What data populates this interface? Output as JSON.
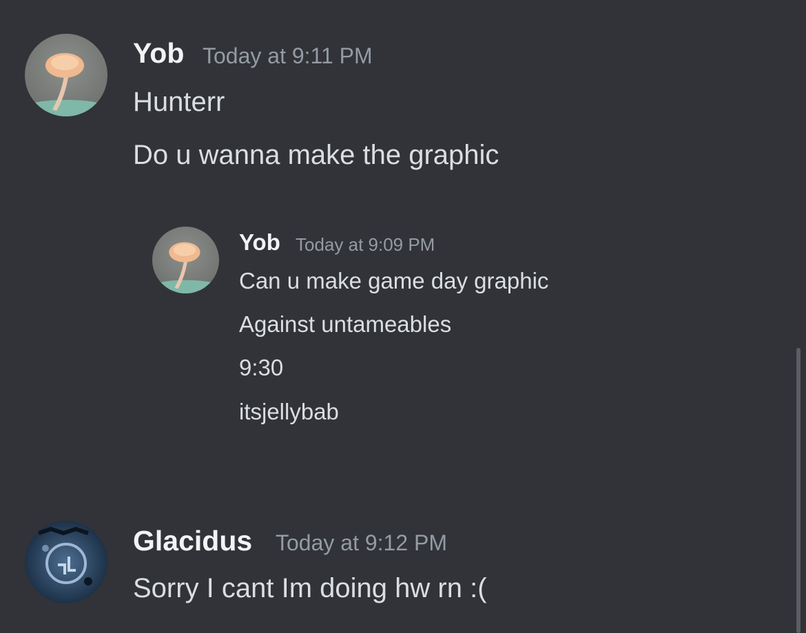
{
  "messages": [
    {
      "author": "Yob",
      "timestamp": "Today at 9:11 PM",
      "avatar": "mushroom-avatar",
      "lines": [
        "Hunterr",
        "Do u wanna make the graphic"
      ]
    },
    {
      "author": "Yob",
      "timestamp": "Today at 9:09 PM",
      "avatar": "mushroom-avatar",
      "lines": [
        "Can u make game day graphic",
        "Against untameables",
        "9:30",
        "itsjellybab"
      ]
    },
    {
      "author": "Glacidus",
      "timestamp": "Today at 9:12 PM",
      "avatar": "dark-blue-emblem-avatar",
      "lines": [
        "Sorry I cant Im doing hw rn :("
      ]
    }
  ],
  "colors": {
    "background": "#313338",
    "author": "#f2f3f5",
    "timestamp": "#949ba4",
    "text": "#dbdee1"
  }
}
